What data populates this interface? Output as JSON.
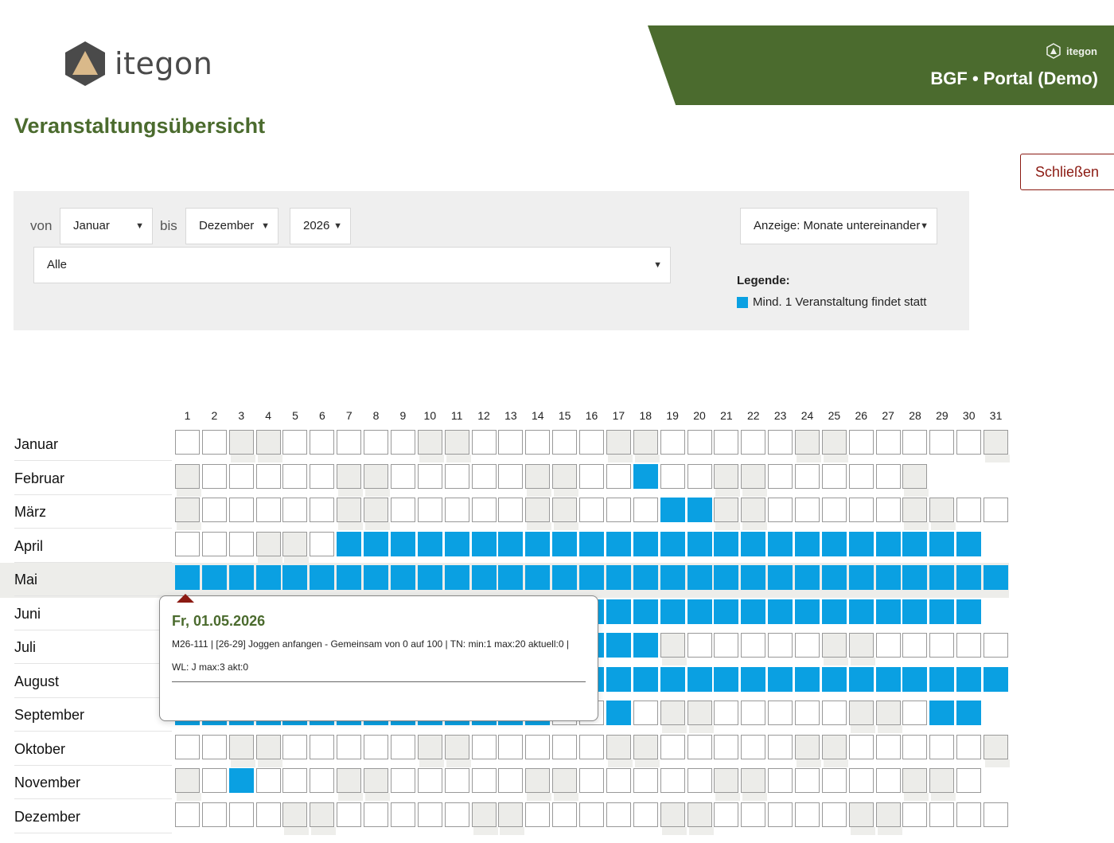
{
  "header": {
    "brand": "itegon",
    "banner_brand": "itegon",
    "banner_title": "BGF • Portal (Demo)"
  },
  "page_title": "Veranstaltungsübersicht",
  "close_label": "Schließen",
  "filter": {
    "from_label": "von",
    "from_value": "Januar",
    "to_label": "bis",
    "to_value": "Dezember",
    "year_value": "2026",
    "category_value": "Alle",
    "display_value": "Anzeige: Monate untereinander"
  },
  "legend": {
    "title": "Legende:",
    "item": "Mind. 1 Veranstaltung findet statt"
  },
  "colors": {
    "active": "#0aa0e2",
    "brand_green": "#4b6b2e",
    "close_red": "#8b1a12"
  },
  "days": [
    "1",
    "2",
    "3",
    "4",
    "5",
    "6",
    "7",
    "8",
    "9",
    "10",
    "11",
    "12",
    "13",
    "14",
    "15",
    "16",
    "17",
    "18",
    "19",
    "20",
    "21",
    "22",
    "23",
    "24",
    "25",
    "26",
    "27",
    "28",
    "29",
    "30",
    "31"
  ],
  "months": [
    {
      "name": "Januar",
      "days": 31,
      "active": []
    },
    {
      "name": "Februar",
      "days": 28,
      "active": [
        18
      ]
    },
    {
      "name": "März",
      "days": 31,
      "active": [
        19,
        20
      ]
    },
    {
      "name": "April",
      "days": 30,
      "active": [
        7,
        8,
        9,
        10,
        11,
        12,
        13,
        14,
        15,
        16,
        17,
        18,
        19,
        20,
        21,
        22,
        23,
        24,
        25,
        26,
        27,
        28,
        29,
        30
      ]
    },
    {
      "name": "Mai",
      "days": 31,
      "active": [
        1,
        2,
        3,
        4,
        5,
        6,
        7,
        8,
        9,
        10,
        11,
        12,
        13,
        14,
        15,
        16,
        17,
        18,
        19,
        20,
        21,
        22,
        23,
        24,
        25,
        26,
        27,
        28,
        29,
        30,
        31
      ]
    },
    {
      "name": "Juni",
      "days": 30,
      "active": [
        1,
        2,
        3,
        4,
        5,
        6,
        7,
        8,
        9,
        10,
        11,
        12,
        13,
        14,
        15,
        16,
        17,
        18,
        19,
        20,
        21,
        22,
        23,
        24,
        25,
        26,
        27,
        28,
        29,
        30
      ]
    },
    {
      "name": "Juli",
      "days": 31,
      "active": [
        1,
        2,
        3,
        4,
        5,
        6,
        7,
        8,
        9,
        10,
        11,
        12,
        13,
        14,
        15,
        16,
        17,
        18
      ]
    },
    {
      "name": "August",
      "days": 31,
      "active": [
        1,
        2,
        3,
        4,
        5,
        6,
        7,
        8,
        9,
        10,
        11,
        12,
        13,
        14,
        15,
        16,
        17,
        18,
        19,
        20,
        21,
        22,
        23,
        24,
        25,
        26,
        27,
        28,
        29,
        30,
        31
      ]
    },
    {
      "name": "September",
      "days": 30,
      "active": [
        1,
        2,
        3,
        4,
        5,
        6,
        7,
        8,
        9,
        10,
        11,
        12,
        13,
        14,
        17,
        29,
        30
      ]
    },
    {
      "name": "Oktober",
      "days": 31,
      "active": []
    },
    {
      "name": "November",
      "days": 30,
      "active": [
        3
      ]
    },
    {
      "name": "Dezember",
      "days": 31,
      "active": []
    }
  ],
  "tooltip": {
    "date": "Fr, 01.05.2026",
    "line1": "M26-111 | [26-29] Joggen anfangen - Gemeinsam von 0 auf 100 | TN: min:1 max:20 aktuell:0 |",
    "line2": "WL: J max:3 akt:0"
  }
}
